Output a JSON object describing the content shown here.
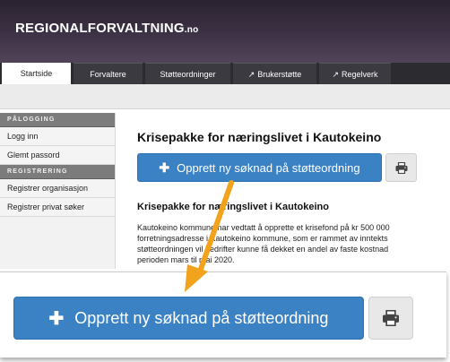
{
  "header": {
    "brand": "REGIONALFORVALTNING",
    "brand_tld": ".no"
  },
  "nav": {
    "tabs": [
      {
        "label": "Startside",
        "external": false,
        "active": true
      },
      {
        "label": "Forvaltere",
        "external": false,
        "active": false
      },
      {
        "label": "Støtteordninger",
        "external": false,
        "active": false
      },
      {
        "label": "Brukerstøtte",
        "external": true,
        "active": false
      },
      {
        "label": "Regelverk",
        "external": true,
        "active": false
      }
    ]
  },
  "sidebar": {
    "login_heading": "PÅLOGGING",
    "login_items": [
      "Logg inn",
      "Glemt passord"
    ],
    "register_heading": "REGISTRERING",
    "register_items": [
      "Registrer organisasjon",
      "Registrer privat søker"
    ]
  },
  "main": {
    "title": "Krisepakke for næringslivet i Kautokeino",
    "primary_button": "Opprett ny søknad på støtteordning",
    "print_icon": "print-icon",
    "subtitle": "Krisepakke for næringslivet i Kautokeino",
    "paragraph_lines": [
      "Kautokeino kommune har vedtatt å opprette et krisefond på kr 500 000",
      "forretningsadresse i Kautokeino kommune, som er rammet av inntekts",
      "støtteordningen vil bedrifter kunne få dekket en andel av faste kostnad",
      "perioden mars til mai 2020."
    ]
  },
  "zoom": {
    "primary_button": "Opprett ny søknad på støtteordning"
  },
  "colors": {
    "primary": "#3b82c4",
    "arrow": "#f2a21b",
    "header": "#3e3246"
  }
}
